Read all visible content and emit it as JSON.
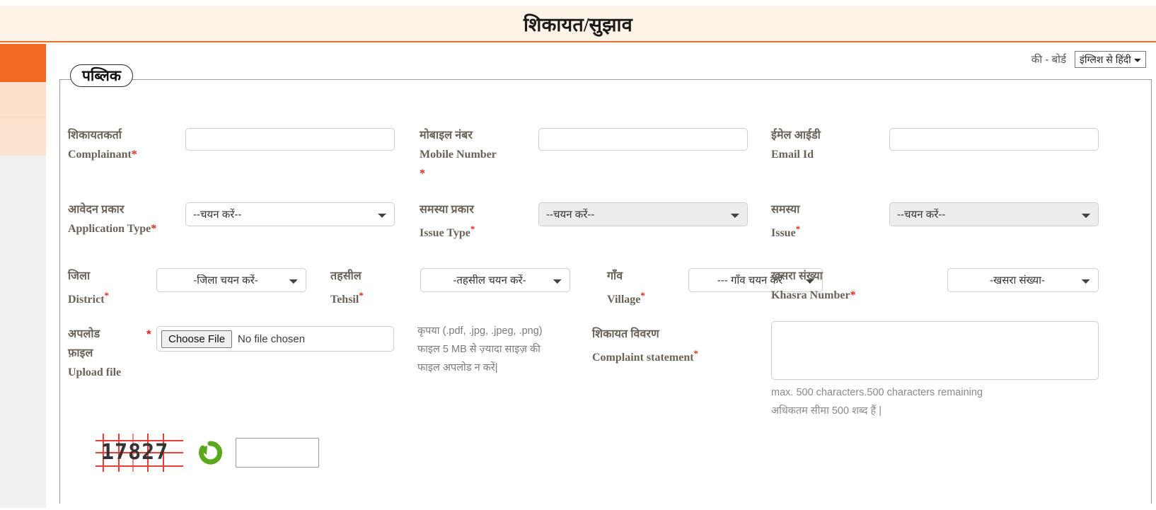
{
  "header": {
    "title": "शिकायत/सुझाव"
  },
  "keyboard": {
    "label": "की - बोर्ड",
    "selected": "इंग्लिश से हिंदी",
    "options": [
      "इंग्लिश से हिंदी"
    ]
  },
  "fieldset": {
    "legend": "पब्लिक"
  },
  "fields": {
    "complainant": {
      "hi": "शिकायतकर्ता",
      "en": "Complainant",
      "required": "*",
      "value": "",
      "placeholder": ""
    },
    "mobile": {
      "hi": "मोबाइल नंबर",
      "en": "Mobile Number",
      "required": "*",
      "value": "",
      "placeholder": ""
    },
    "email": {
      "hi": "ईमेल आईडी",
      "en": "Email Id",
      "required": "",
      "value": "",
      "placeholder": ""
    },
    "application_type": {
      "hi": "आवेदन प्रकार",
      "en": "Application Type",
      "required": "*",
      "selected": "--चयन करें--"
    },
    "issue_type": {
      "hi": "समस्या प्रकार",
      "en": "Issue Type",
      "required": "*",
      "selected": "--चयन करें--"
    },
    "issue": {
      "hi": "समस्या",
      "en": "Issue",
      "required": "*",
      "selected": "--चयन करें--"
    },
    "district": {
      "hi": "जिला",
      "en": "District",
      "required": "*",
      "selected": "-जिला चयन करें-"
    },
    "tehsil": {
      "hi": "तहसील",
      "en": "Tehsil",
      "required": "*",
      "selected": "-तहसील चयन करें-"
    },
    "village": {
      "hi": "गाँव",
      "en": "Village",
      "required": "*",
      "selected": "--- गाँव चयन करें"
    },
    "khasra": {
      "hi": "खसरा संख्या",
      "en": "Khasra Number",
      "required": "*",
      "selected": "-खसरा संख्या-"
    },
    "upload": {
      "hi1": "अपलोड",
      "hi2": "फ़ाइल",
      "en": "Upload file",
      "required": "*",
      "button_label": "Choose File",
      "file_status": "No file chosen",
      "hint_line1": "कृपया (.pdf, .jpg, .jpeg, .png)",
      "hint_line2": "फाइल 5 MB से ज़्यादा साइज़ की",
      "hint_line3": "फाइल अपलोड न करें|"
    },
    "complaint_statement": {
      "hi": "शिकायत विवरण",
      "en": "Complaint statement",
      "required": "*",
      "value": "",
      "counter_en": "max. 500 characters.500 characters remaining",
      "counter_hi": "अधिकतम सीमा 500 शब्द हैं |"
    },
    "captcha": {
      "code": "17827",
      "value": "",
      "refresh_icon": "refresh-icon"
    }
  },
  "colors": {
    "accent": "#f26a21",
    "title_bg": "#fdf3e7",
    "required": "#e2241b",
    "label": "#6b6257",
    "captcha_grid": "#ef3b36",
    "refresh_green": "#5aa81c"
  }
}
